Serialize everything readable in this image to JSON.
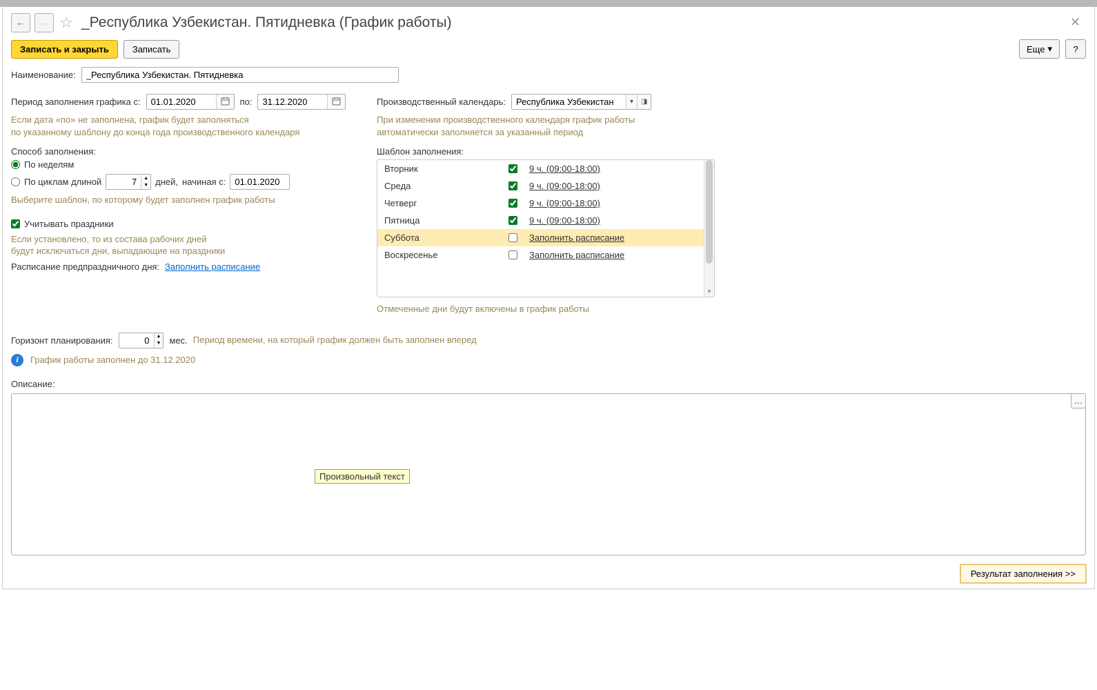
{
  "header": {
    "title": "_Республика Узбекистан. Пятидневка (График работы)"
  },
  "toolbar": {
    "save_close": "Записать и закрыть",
    "save": "Записать",
    "more": "Еще",
    "help": "?"
  },
  "name_row": {
    "label": "Наименование:",
    "value": "_Республика Узбекистан. Пятидневка"
  },
  "period": {
    "label": "Период заполнения графика с:",
    "from": "01.01.2020",
    "to_label": "по:",
    "to": "31.12.2020",
    "hint1": "Если дата «по» не заполнена, график будет заполняться",
    "hint2": "по указанному шаблону до конца года производственного календаря"
  },
  "method": {
    "label": "Способ заполнения:",
    "by_weeks": "По неделям",
    "by_cycles": "По циклам длиной",
    "cycle_val": "7",
    "days_label": "дней,",
    "starting_label": "начиная с:",
    "start_date": "01.01.2020",
    "hint": "Выберите шаблон, по которому будет заполнен график работы"
  },
  "holidays": {
    "label": "Учитывать праздники",
    "hint1": "Если установлено, то из состава рабочих дней",
    "hint2": "будут исключаться дни, выпадающие на праздники",
    "preholiday_label": "Расписание предпраздничного дня:",
    "fill_link": "Заполнить расписание"
  },
  "calendar": {
    "label": "Производственный календарь:",
    "value": "Республика Узбекистан",
    "hint1": "При изменении производственного календаря график работы",
    "hint2": "автоматически заполняется за указанный период"
  },
  "template": {
    "label": "Шаблон заполнения:",
    "days": [
      {
        "name": "Вторник",
        "checked": true,
        "schedule": "9 ч. (09:00-18:00)",
        "highlighted": false
      },
      {
        "name": "Среда",
        "checked": true,
        "schedule": "9 ч. (09:00-18:00)",
        "highlighted": false
      },
      {
        "name": "Четверг",
        "checked": true,
        "schedule": "9 ч. (09:00-18:00)",
        "highlighted": false
      },
      {
        "name": "Пятница",
        "checked": true,
        "schedule": "9 ч. (09:00-18:00)",
        "highlighted": false
      },
      {
        "name": "Суббота",
        "checked": false,
        "schedule": "Заполнить расписание",
        "highlighted": true
      },
      {
        "name": "Воскресенье",
        "checked": false,
        "schedule": "Заполнить расписание",
        "highlighted": false
      }
    ],
    "hint": "Отмеченные дни будут включены в график работы"
  },
  "horizon": {
    "label": "Горизонт планирования:",
    "value": "0",
    "months": "мес.",
    "hint": "Период времени, на который график должен быть заполнен вперед"
  },
  "info": {
    "text": "График работы заполнен до 31.12.2020"
  },
  "description": {
    "label": "Описание:",
    "tooltip": "Произвольный текст"
  },
  "footer": {
    "result": "Результат заполнения >>"
  }
}
